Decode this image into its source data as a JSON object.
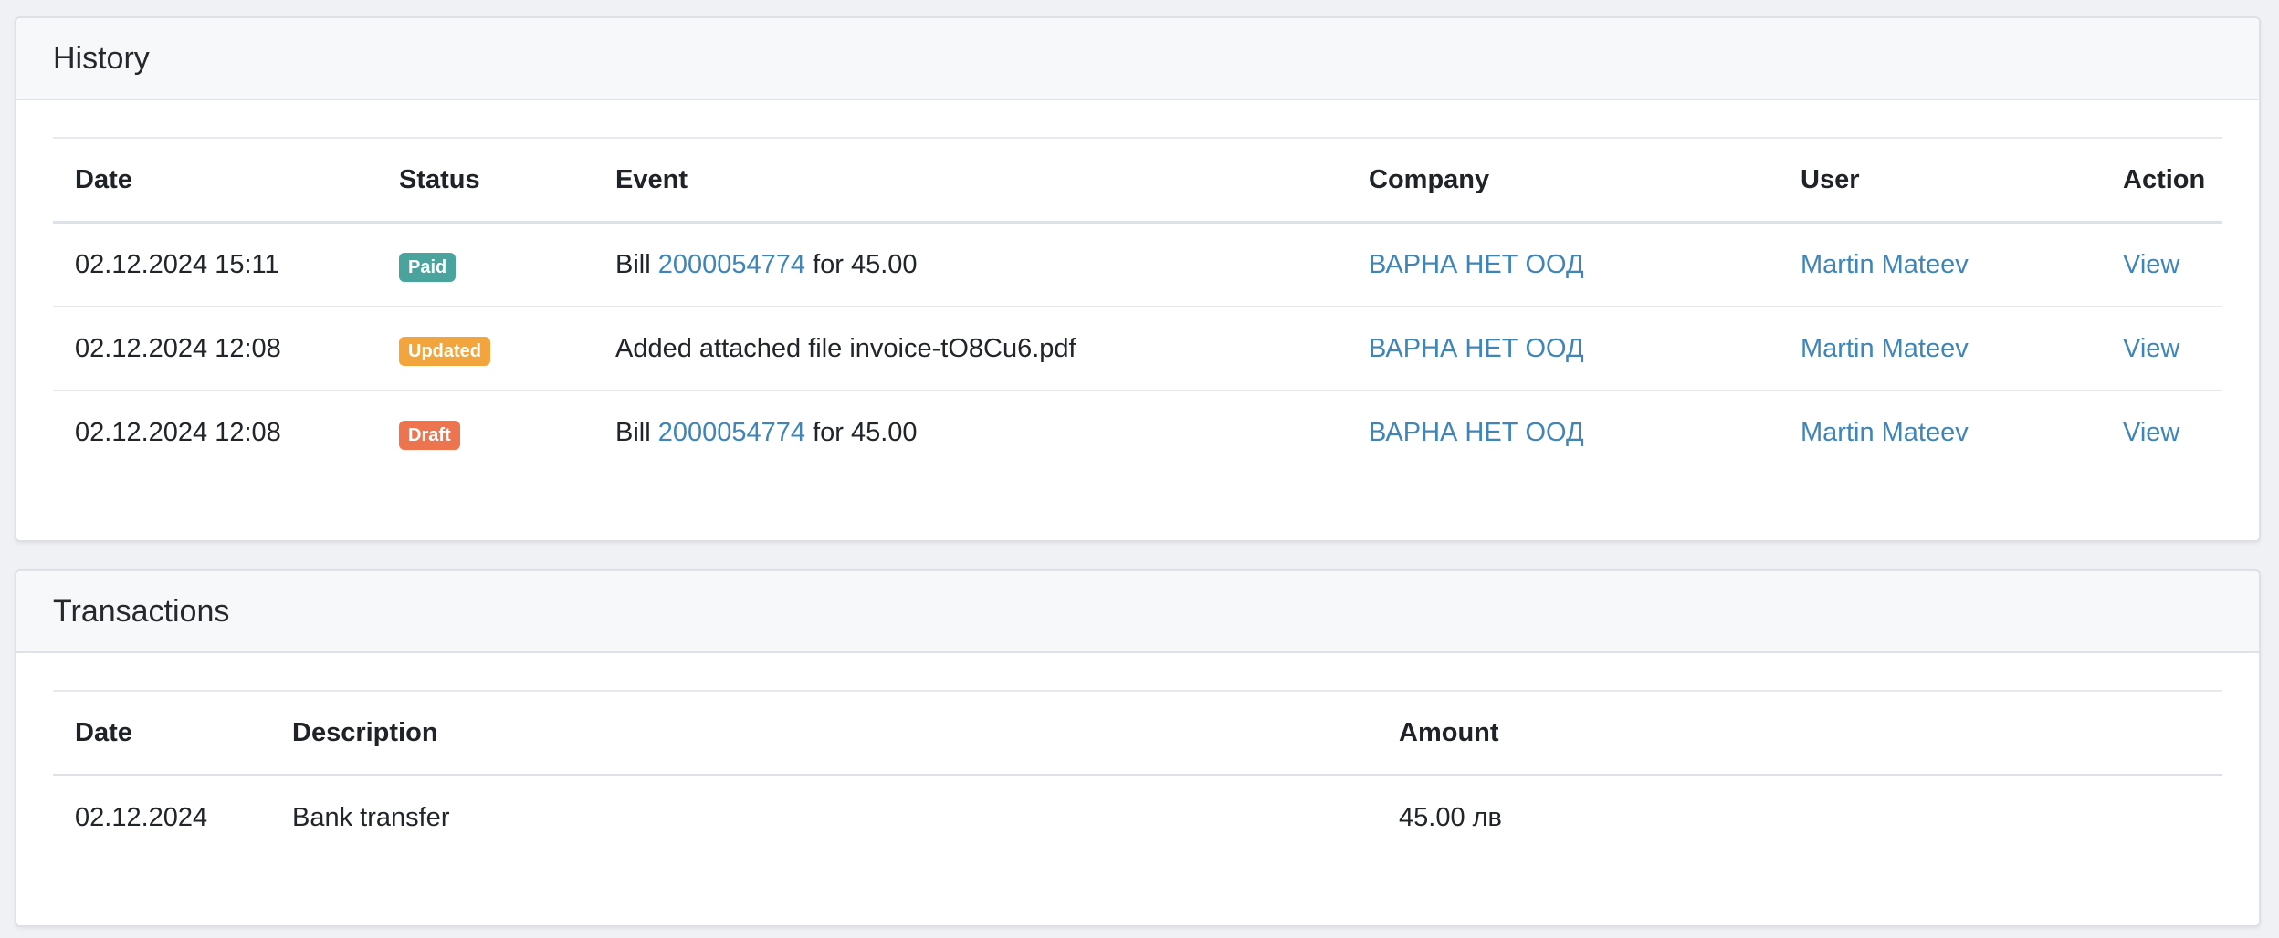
{
  "history": {
    "title": "History",
    "columns": [
      "Date",
      "Status",
      "Event",
      "Company",
      "User",
      "Action"
    ],
    "rows": [
      {
        "date": "02.12.2024 15:11",
        "status": "Paid",
        "status_color": "#4aa39c",
        "event_prefix": "Bill ",
        "event_link": "2000054774",
        "event_suffix": " for 45.00",
        "company": "ВАРНА НЕТ ООД",
        "user": "Martin Mateev",
        "action": "View"
      },
      {
        "date": "02.12.2024 12:08",
        "status": "Updated",
        "status_color": "#f2a53c",
        "event_prefix": "Added attached file invoice-tO8Cu6.pdf",
        "event_link": "",
        "event_suffix": "",
        "company": "ВАРНА НЕТ ООД",
        "user": "Martin Mateev",
        "action": "View"
      },
      {
        "date": "02.12.2024 12:08",
        "status": "Draft",
        "status_color": "#ec7550",
        "event_prefix": "Bill ",
        "event_link": "2000054774",
        "event_suffix": " for 45.00",
        "company": "ВАРНА НЕТ ООД",
        "user": "Martin Mateev",
        "action": "View"
      }
    ]
  },
  "transactions": {
    "title": "Transactions",
    "columns": [
      "Date",
      "Description",
      "Amount"
    ],
    "rows": [
      {
        "date": "02.12.2024",
        "description": "Bank transfer",
        "amount": "45.00 лв"
      }
    ]
  },
  "colors": {
    "link": "#3f85b8",
    "background": "#f0f1f5"
  }
}
